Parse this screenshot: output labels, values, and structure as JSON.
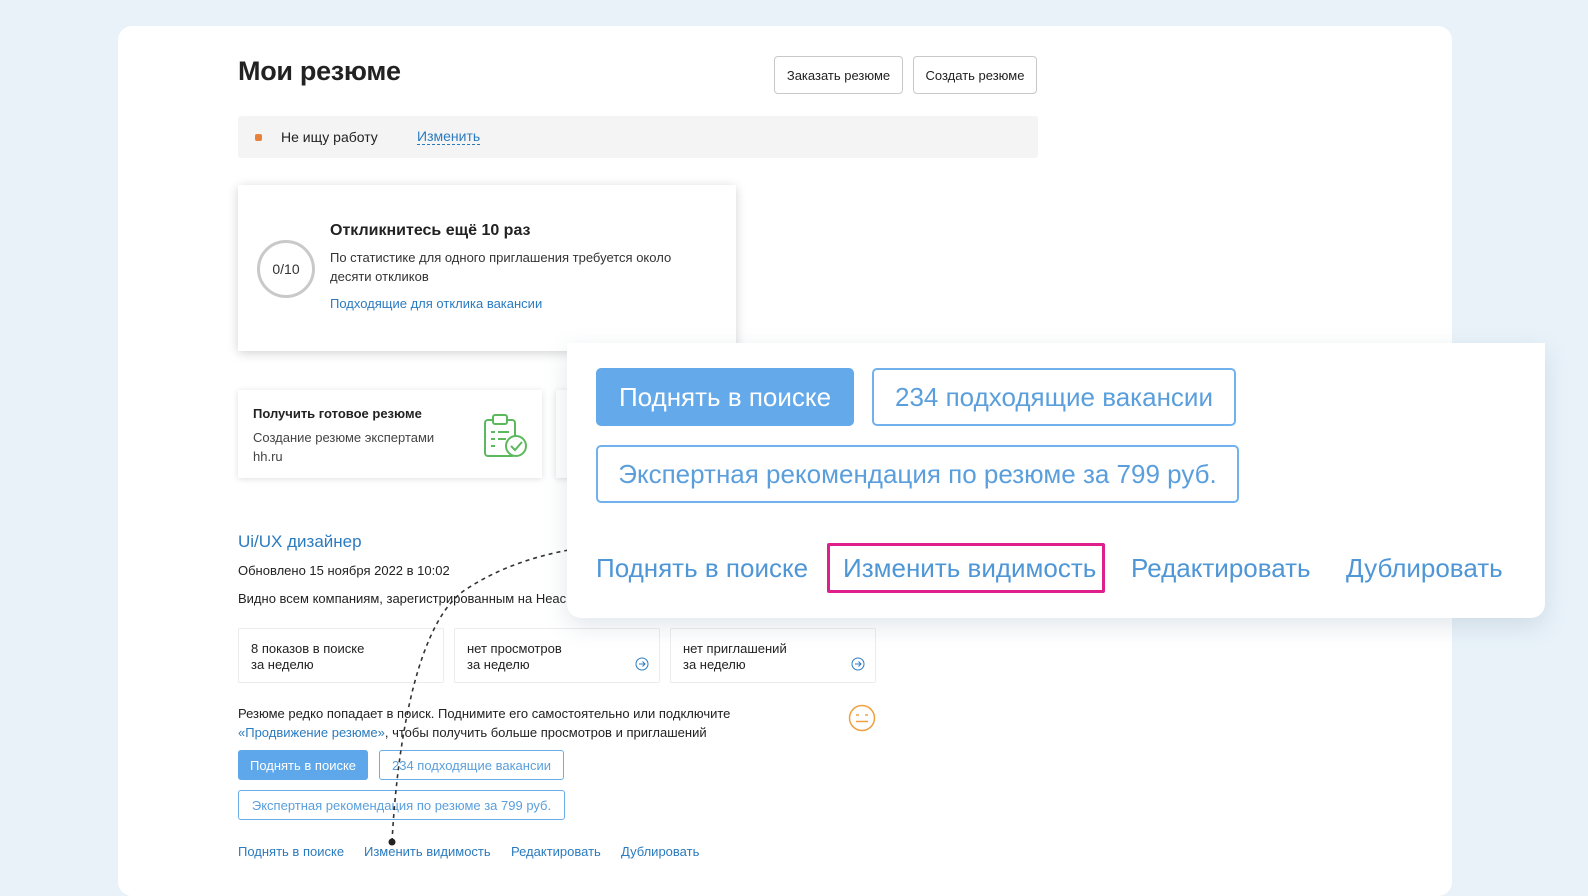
{
  "header": {
    "title": "Мои резюме",
    "order_button": "Заказать резюме",
    "create_button": "Создать резюме"
  },
  "status": {
    "text": "Не ищу работу",
    "change_link": "Изменить",
    "dot_color": "#e8823a"
  },
  "progress_card": {
    "counter": "0/10",
    "title": "Откликнитесь ещё 10 раз",
    "text": "По статистике для одного приглашения требуется около десяти откликов",
    "link": "Подходящие для отклика вакансии"
  },
  "ready_card": {
    "title": "Получить готовое резюме",
    "text": "Создание резюме экспертами hh.ru",
    "icon": "clipboard-check-icon"
  },
  "resume": {
    "title": "Ui/UX дизайнер",
    "updated": "Обновлено 15 ноября 2022 в 10:02",
    "visibility": "Видно всем компаниям, зарегистрированным на Heac",
    "stats": [
      {
        "line1": "8 показов в поиске",
        "line2": "за неделю"
      },
      {
        "line1": "нет просмотров",
        "line2": "за неделю"
      },
      {
        "line1": "нет приглашений",
        "line2": "за неделю"
      }
    ],
    "hint_text": "Резюме редко попадает в поиск. Поднимите его самостоятельно или подключите",
    "hint_link": "«Продвижение резюме»",
    "hint_tail": ", чтобы получить больше просмотров и приглашений",
    "raise_button": "Поднять в поиске",
    "vacancies_button": "234 подходящие вакансии",
    "expert_button": "Экспертная рекомендация по резюме за 799 руб.",
    "links": {
      "raise": "Поднять в поиске",
      "visibility": "Изменить видимость",
      "edit": "Редактировать",
      "duplicate": "Дублировать"
    }
  },
  "zoom": {
    "raise_button": "Поднять в поиске",
    "vacancies_button": "234 подходящие вакансии",
    "expert_button": "Экспертная рекомендация по резюме за 799 руб.",
    "links": {
      "raise": "Поднять в поиске",
      "visibility": "Изменить видимость",
      "edit": "Редактировать",
      "duplicate": "Дублировать"
    },
    "highlight_color": "#e0208a"
  }
}
